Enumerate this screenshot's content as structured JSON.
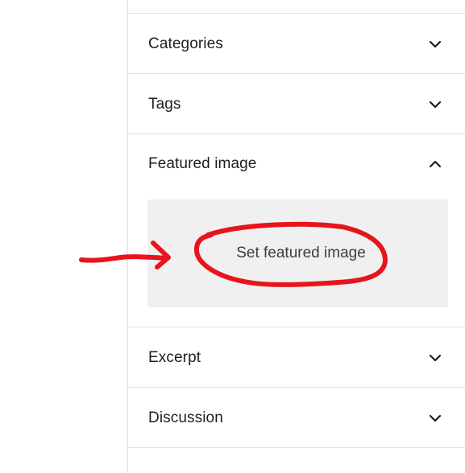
{
  "panels": {
    "categories": {
      "title": "Categories",
      "expanded": false
    },
    "tags": {
      "title": "Tags",
      "expanded": false
    },
    "featured_image": {
      "title": "Featured image",
      "expanded": true,
      "button_label": "Set featured image"
    },
    "excerpt": {
      "title": "Excerpt",
      "expanded": false
    },
    "discussion": {
      "title": "Discussion",
      "expanded": false
    }
  },
  "annotation": {
    "color": "#e8141c",
    "shapes": [
      "arrow",
      "circle"
    ]
  },
  "colors": {
    "divider": "#e0e0e0",
    "box_background": "#f0f0f0",
    "text": "#1e1e1e"
  }
}
